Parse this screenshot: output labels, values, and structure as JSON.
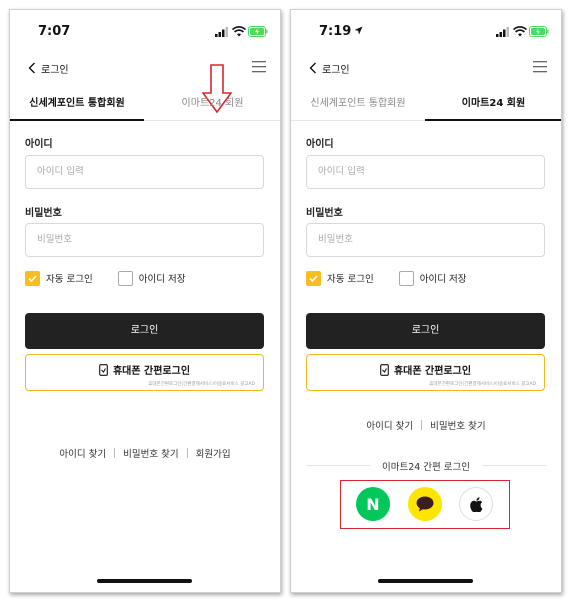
{
  "screens": [
    {
      "status_time": "7:07",
      "back_label": "로그인",
      "tabs": [
        "신세계포인트 통합회원",
        "이마트24 회원"
      ],
      "active_tab": 0,
      "id_label": "아이디",
      "id_placeholder": "아이디 입력",
      "pw_label": "비밀번호",
      "pw_placeholder": "비밀번호",
      "auto_login": "자동 로그인",
      "save_id": "아이디 저장",
      "login_button": "로그인",
      "phone_login_button": "휴대폰 간편로그인",
      "phone_login_sub": "휴대폰간편로그인(간편결제서비스)이용료서비스 광고AD",
      "links": [
        "아이디 찾기",
        "비밀번호 찾기",
        "회원가입"
      ]
    },
    {
      "status_time": "7:19",
      "back_label": "로그인",
      "tabs": [
        "신세계포인트 통합회원",
        "이마트24 회원"
      ],
      "active_tab": 1,
      "id_label": "아이디",
      "id_placeholder": "아이디 입력",
      "pw_label": "비밀번호",
      "pw_placeholder": "비밀번호",
      "auto_login": "자동 로그인",
      "save_id": "아이디 저장",
      "login_button": "로그인",
      "phone_login_button": "휴대폰 간편로그인",
      "phone_login_sub": "휴대폰간편로그인(간편결제서비스)이용료서비스 광고AD",
      "links": [
        "아이디 찾기",
        "비밀번호 찾기"
      ],
      "easy_login_title": "이마트24 간편 로그인",
      "social": [
        {
          "name": "naver",
          "letter": "N",
          "color": "#03c75a"
        },
        {
          "name": "kakao",
          "color": "#fee500"
        },
        {
          "name": "apple",
          "color": "#ffffff"
        }
      ]
    }
  ],
  "colors": {
    "accent_yellow": "#f7be1f",
    "dark_button": "#222222",
    "annotation_red": "#d9262e"
  }
}
